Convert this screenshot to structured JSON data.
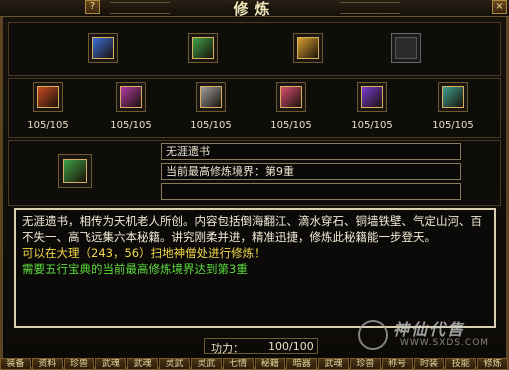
{
  "window": {
    "title": "修炼",
    "help_label": "?",
    "close_label": "×"
  },
  "top_books": [
    {
      "icon": "blue-book-icon",
      "color": "#3a6fd8"
    },
    {
      "icon": "green-book-icon",
      "color": "#3fa046"
    },
    {
      "icon": "gold-book-icon",
      "color": "#d8a030"
    },
    {
      "icon": "empty-slot-icon",
      "color": "#2b2b2b"
    }
  ],
  "skill_books": [
    {
      "icon": "red-book-icon",
      "color": "#c84a20",
      "count": "105/105"
    },
    {
      "icon": "purple-book-icon",
      "color": "#b03aa0",
      "count": "105/105"
    },
    {
      "icon": "grey-book-icon",
      "color": "#a0a0a0",
      "count": "105/105"
    },
    {
      "icon": "pink-book-icon",
      "color": "#d85070",
      "count": "105/105"
    },
    {
      "icon": "violet-book-icon",
      "color": "#7a3ad0",
      "count": "105/105"
    },
    {
      "icon": "teal-book-icon",
      "color": "#40a090",
      "count": "105/105"
    }
  ],
  "selected": {
    "icon": "green-book-icon",
    "name": "无涯遗书",
    "realm": "当前最高修炼境界：第9重",
    "extra": ""
  },
  "description": {
    "line1": "无涯遗书，相传为天机老人所创。内容包括倒海翻江、滴水穿石、铜墙铁壁、气定山河、百不失一、高飞远集六本秘籍。讲究刚柔并进，精准迅捷，修炼此秘籍能一步登天。",
    "line2": "可以在大理（243，56）扫地神僧处进行修炼！",
    "line3": "需要五行宝典的当前最高修炼境界达到第3重"
  },
  "power": {
    "label": "功力：",
    "value": "100/100"
  },
  "tabs": [
    "装备",
    "资料",
    "珍兽",
    "武魂",
    "武魂",
    "灵武",
    "灵武",
    "七情",
    "秘籍",
    "暗器",
    "武魂",
    "珍兽",
    "称号",
    "时装",
    "技能",
    "修炼"
  ],
  "watermark": {
    "text": "神仙代售",
    "url": "WWW.SXDS.COM"
  }
}
